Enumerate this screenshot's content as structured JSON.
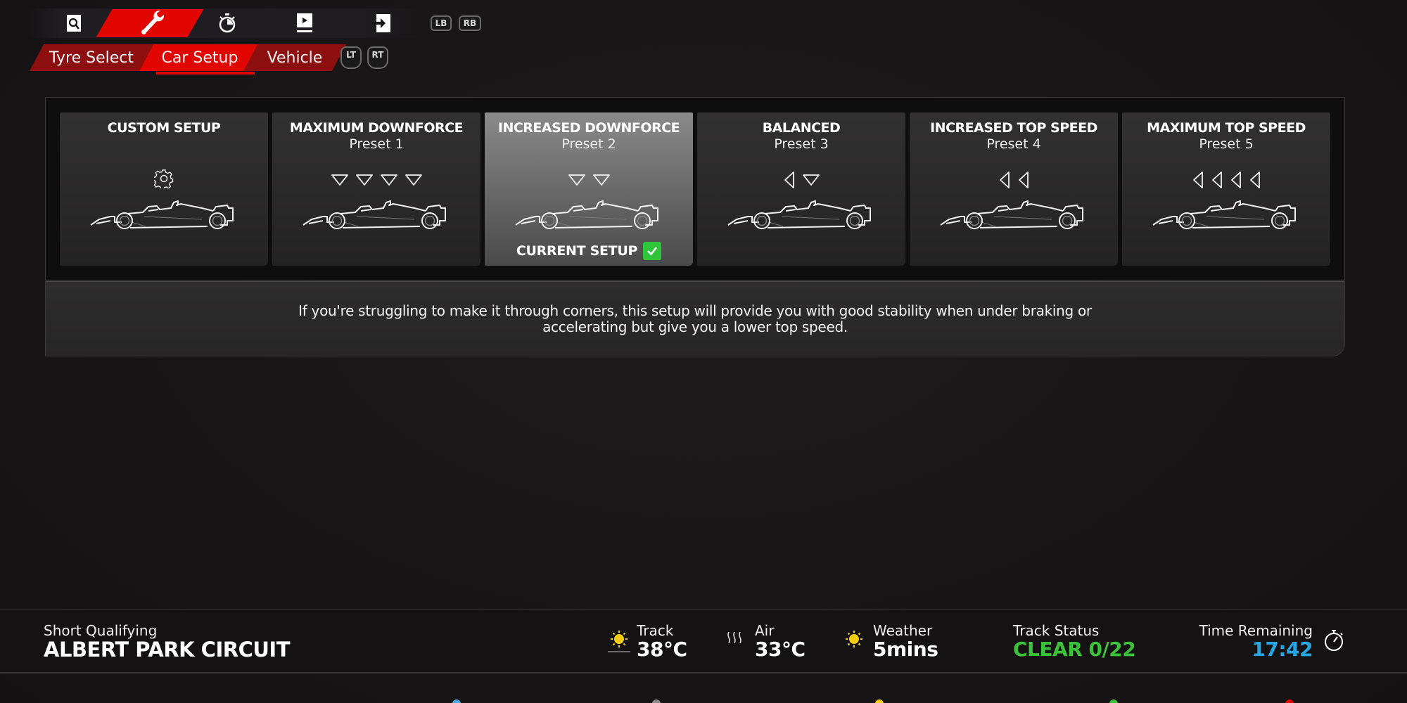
{
  "top_nav": {
    "icons": [
      {
        "name": "search-tab",
        "icon": "magnifier-icon"
      },
      {
        "name": "car-setup-tab",
        "icon": "wrench-icon",
        "active": true
      },
      {
        "name": "timing-tab",
        "icon": "stopwatch-icon"
      },
      {
        "name": "replay-tab",
        "icon": "play-icon"
      },
      {
        "name": "exit-tab",
        "icon": "exit-icon"
      }
    ],
    "hints": {
      "lb": "LB",
      "rb": "RB",
      "lt": "LT",
      "rt": "RT"
    }
  },
  "sub_tabs": [
    {
      "label": "Tyre Select",
      "active": false
    },
    {
      "label": "Car Setup",
      "active": true
    },
    {
      "label": "Vehicle",
      "active": false
    }
  ],
  "presets": [
    {
      "title": "CUSTOM SETUP",
      "subtitle": "",
      "icon": "gear",
      "arrows": []
    },
    {
      "title": "MAXIMUM DOWNFORCE",
      "subtitle": "Preset 1",
      "arrows": [
        "down",
        "down",
        "down",
        "down"
      ]
    },
    {
      "title": "INCREASED DOWNFORCE",
      "subtitle": "Preset 2",
      "arrows": [
        "down",
        "down"
      ],
      "selected": true,
      "current": true
    },
    {
      "title": "BALANCED",
      "subtitle": "Preset 3",
      "arrows": [
        "left",
        "down"
      ]
    },
    {
      "title": "INCREASED TOP SPEED",
      "subtitle": "Preset 4",
      "arrows": [
        "left",
        "left"
      ]
    },
    {
      "title": "MAXIMUM TOP SPEED",
      "subtitle": "Preset 5",
      "arrows": [
        "left",
        "left",
        "left",
        "left"
      ]
    }
  ],
  "current_setup_label": "CURRENT SETUP",
  "description": "If you're struggling to make it through corners, this setup will provide you with good stability when under braking or accelerating but give you a lower top speed.",
  "info_bar": {
    "session_type": "Short Qualifying",
    "circuit": "ALBERT PARK CIRCUIT",
    "track_label": "Track",
    "track_temp": "38°C",
    "air_label": "Air",
    "air_temp": "33°C",
    "weather_label": "Weather",
    "weather_value": "5mins",
    "status_label": "Track Status",
    "status_value": "CLEAR 0/22",
    "time_label": "Time Remaining",
    "time_value": "17:42"
  },
  "colors": {
    "accent_red": "#e10600",
    "dark_red": "#8e0f10",
    "status_green": "#3cc13b",
    "time_blue": "#27a6e5",
    "sun_yellow": "#f5cc14",
    "check_green": "#2fc53a"
  },
  "bottom_dots": [
    "#4aa8e0",
    "#8a8a8a",
    "#f5cc14",
    "#3cc13b",
    "#e10600"
  ]
}
